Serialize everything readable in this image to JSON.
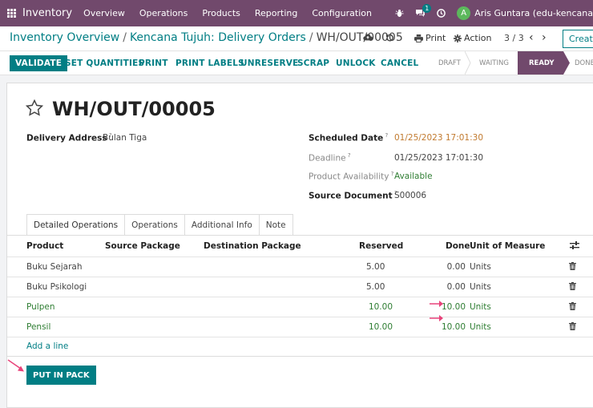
{
  "topnav": {
    "app_name": "Inventory",
    "menu": [
      "Overview",
      "Operations",
      "Products",
      "Reporting",
      "Configuration"
    ],
    "chat_badge": "1",
    "avatar_letter": "A",
    "user": "Aris Guntara (edu-kencana"
  },
  "cpanel": {
    "breadcrumb": [
      "Inventory Overview",
      "Kencana Tujuh: Delivery Orders",
      "WH/OUT/00005"
    ],
    "print_label": "Print",
    "action_label": "Action",
    "pager": "3 / 3",
    "create_label": "Create"
  },
  "actions": {
    "validate": "VALIDATE",
    "set_quantities": "SET QUANTITIES",
    "print": "PRINT",
    "print_labels": "PRINT LABELS",
    "unreserve": "UNRESERVE",
    "scrap": "SCRAP",
    "unlock": "UNLOCK",
    "cancel": "CANCEL"
  },
  "statusbar": [
    "DRAFT",
    "WAITING",
    "READY",
    "DONE"
  ],
  "record": {
    "title": "WH/OUT/00005",
    "delivery_address_label": "Delivery Address",
    "delivery_address": "Bulan Tiga",
    "scheduled_date_label": "Scheduled Date",
    "scheduled_date": "01/25/2023 17:01:30",
    "deadline_label": "Deadline",
    "deadline": "01/25/2023 17:01:30",
    "availability_label": "Product Availability",
    "availability": "Available",
    "source_label": "Source Document",
    "source": "S00006"
  },
  "tabs": [
    "Detailed Operations",
    "Operations",
    "Additional Info",
    "Note"
  ],
  "table": {
    "headers": {
      "product": "Product",
      "source_package": "Source Package",
      "destination_package": "Destination Package",
      "reserved": "Reserved",
      "done": "Done",
      "uom": "Unit of Measure"
    },
    "rows": [
      {
        "product": "Buku Sejarah",
        "reserved": "5.00",
        "done": "0.00",
        "uom": "Units"
      },
      {
        "product": "Buku Psikologi",
        "reserved": "5.00",
        "done": "0.00",
        "uom": "Units"
      },
      {
        "product": "Pulpen",
        "reserved": "10.00",
        "done": "10.00",
        "uom": "Units"
      },
      {
        "product": "Pensil",
        "reserved": "10.00",
        "done": "10.00",
        "uom": "Units"
      }
    ],
    "add_line": "Add a line"
  },
  "put_in_pack": "PUT IN PACK",
  "colors": {
    "brand": "#71496c",
    "primary": "#017e84",
    "annotation": "#e8437a"
  }
}
